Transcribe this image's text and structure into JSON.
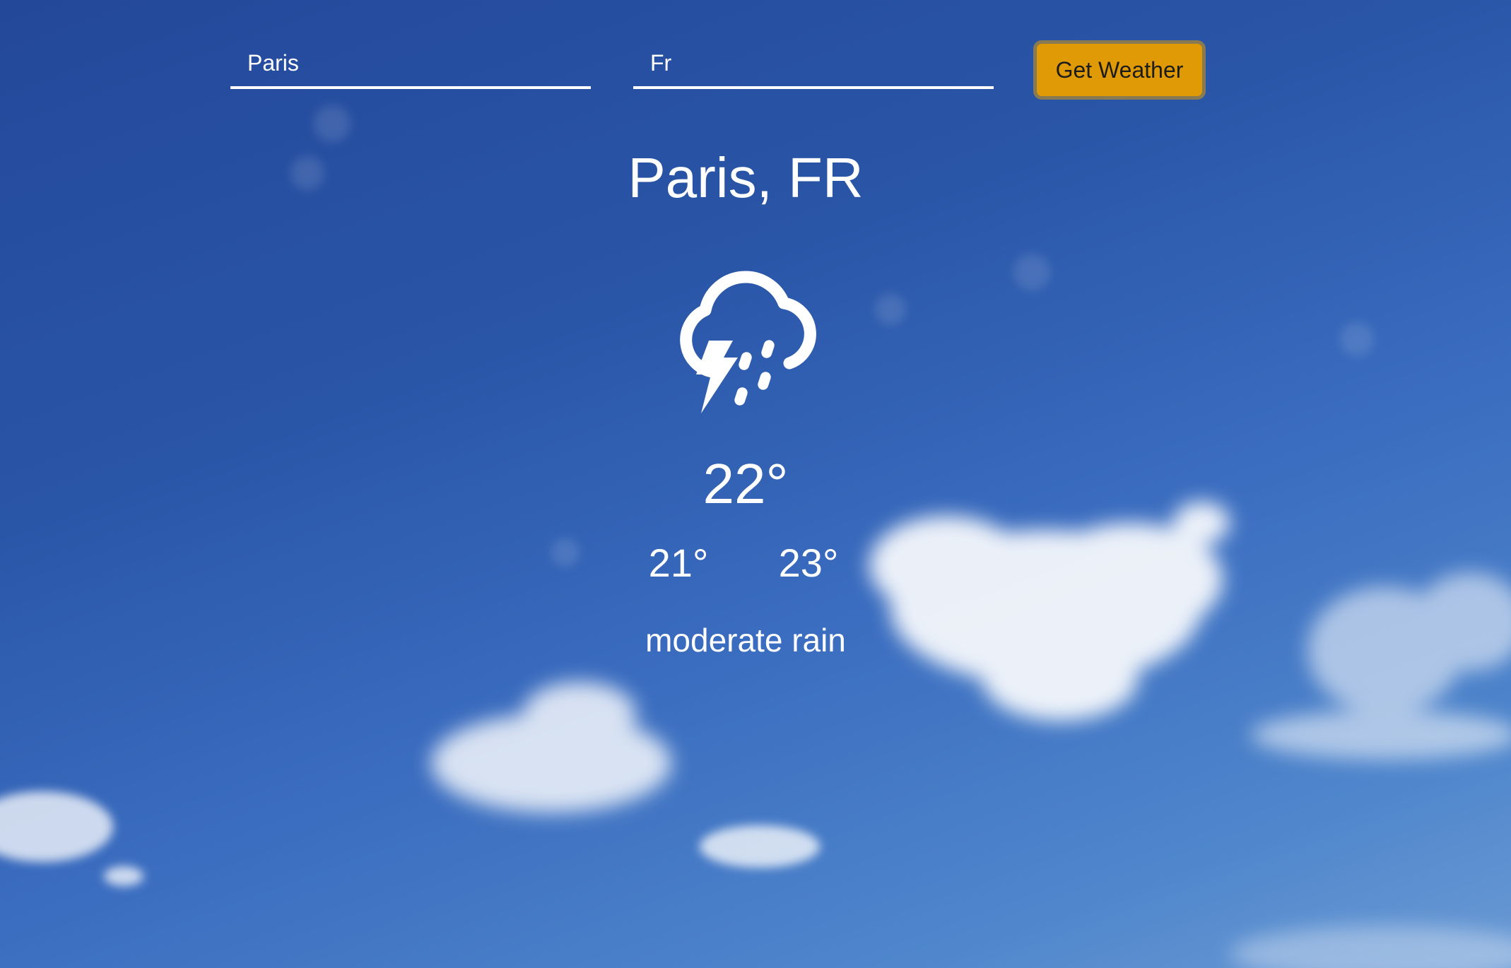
{
  "search": {
    "city_value": "Paris",
    "country_value": "Fr",
    "button_label": "Get Weather"
  },
  "weather": {
    "location": "Paris, FR",
    "condition_icon": "thunderstorm-rain-icon",
    "temperature": "22°",
    "temp_min": "21°",
    "temp_max": "23°",
    "description": "moderate rain"
  },
  "colors": {
    "button_bg": "#df9a06",
    "button_border": "#8a7a52",
    "text": "#ffffff",
    "sky_top": "#23489a",
    "sky_bottom": "#6a9ad4"
  }
}
